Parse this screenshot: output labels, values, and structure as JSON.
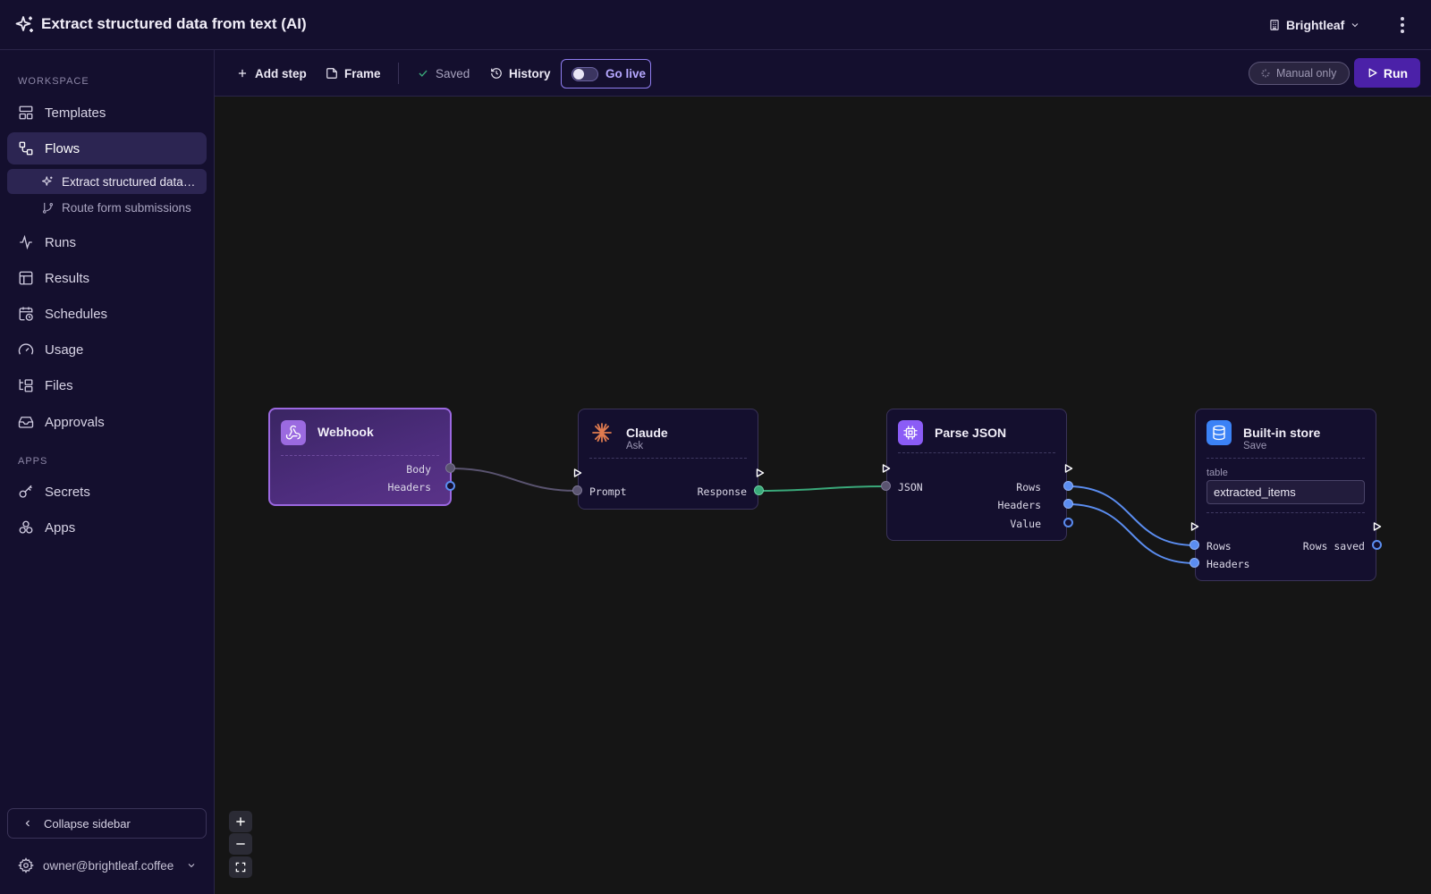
{
  "app": {
    "title": "Extract structured data from text (AI)",
    "org": "Brightleaf"
  },
  "sidebar": {
    "workspace_label": "WORKSPACE",
    "apps_label": "APPS",
    "items": [
      {
        "label": "Templates",
        "icon": "layout-icon"
      },
      {
        "label": "Flows",
        "icon": "workflow-icon",
        "active": true
      },
      {
        "label": "Runs",
        "icon": "activity-icon"
      },
      {
        "label": "Results",
        "icon": "table-icon"
      },
      {
        "label": "Schedules",
        "icon": "calendar-clock-icon"
      },
      {
        "label": "Usage",
        "icon": "gauge-icon"
      },
      {
        "label": "Files",
        "icon": "folder-tree-icon"
      },
      {
        "label": "Approvals",
        "icon": "inbox-icon"
      }
    ],
    "flows": [
      {
        "label": "Extract structured data from text (AI)",
        "icon": "sparkles-icon",
        "active": true
      },
      {
        "label": "Route form submissions",
        "icon": "git-branch-icon"
      }
    ],
    "apps": [
      {
        "label": "Secrets",
        "icon": "key-icon"
      },
      {
        "label": "Apps",
        "icon": "boxes-icon"
      }
    ],
    "collapse_label": "Collapse sidebar",
    "user": "owner@brightleaf.coffee"
  },
  "toolbar": {
    "add_step": "Add step",
    "frame": "Frame",
    "saved": "Saved",
    "history": "History",
    "go_live": "Go live",
    "manual_only": "Manual only",
    "run": "Run"
  },
  "nodes": {
    "webhook": {
      "title": "Webhook",
      "outputs": [
        "Body",
        "Headers"
      ]
    },
    "claude": {
      "title": "Claude",
      "subtitle": "Ask",
      "input": "Prompt",
      "output": "Response"
    },
    "parse": {
      "title": "Parse JSON",
      "input": "JSON",
      "outputs": [
        "Rows",
        "Headers",
        "Value"
      ]
    },
    "store": {
      "title": "Built-in store",
      "subtitle": "Save",
      "field_label": "table",
      "field_value": "extracted_items",
      "inputs": [
        "Rows",
        "Headers"
      ],
      "output": "Rows saved"
    }
  },
  "colors": {
    "accent": "#4b21a8",
    "edge_gray": "#5a5470",
    "edge_green": "#3aa97a",
    "edge_blue": "#5b8df0"
  }
}
